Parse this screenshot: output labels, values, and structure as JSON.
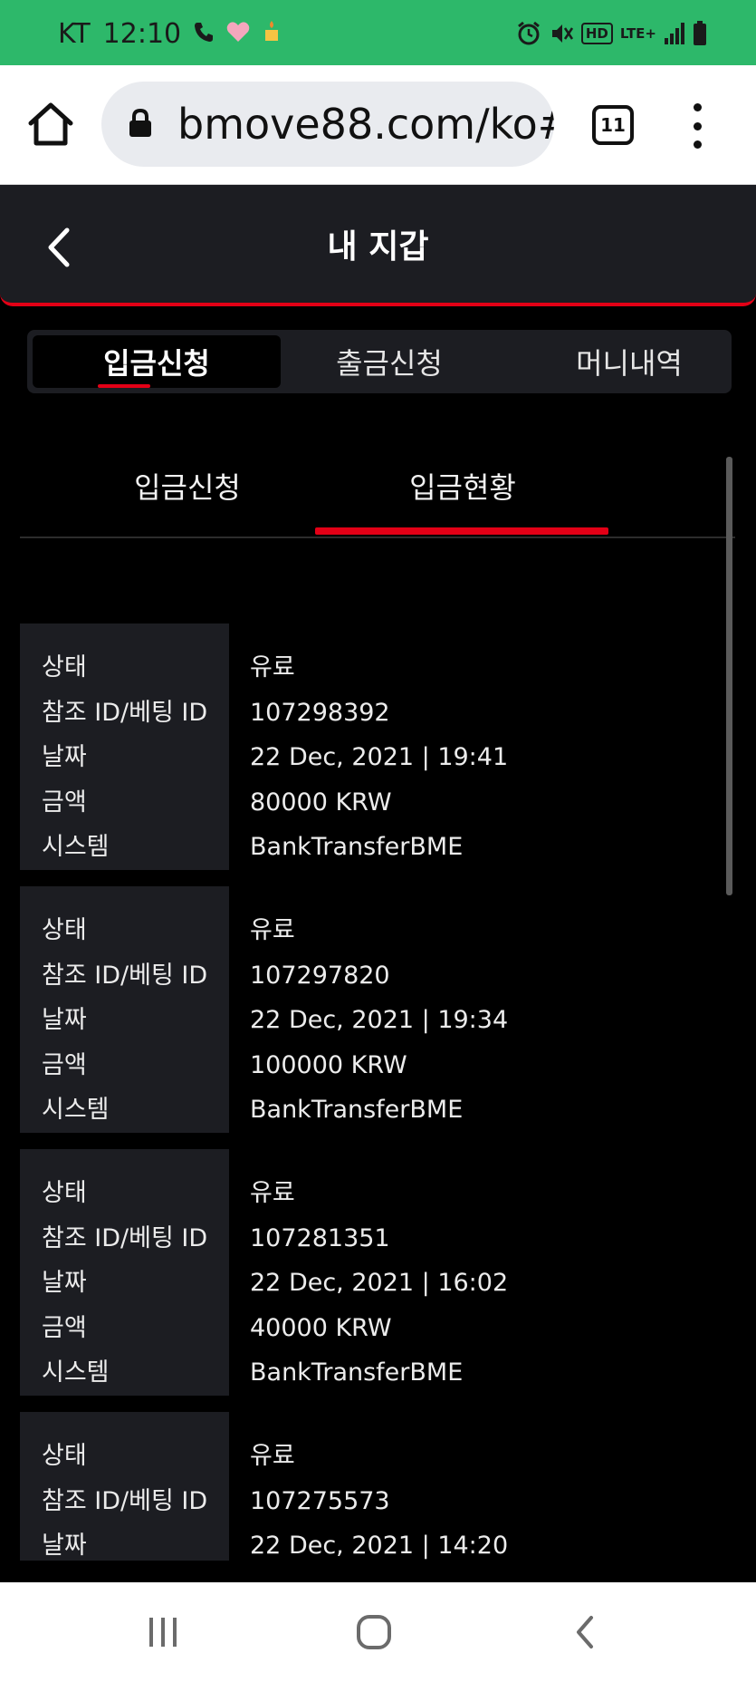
{
  "status_bar": {
    "carrier": "KT",
    "time": "12:10",
    "hd_badge": "HD",
    "network": "LTE+",
    "icons": [
      "phone-icon",
      "heart-icon",
      "notification-icon",
      "alarm-icon",
      "mute-icon",
      "hd-icon",
      "signal-icon",
      "battery-icon"
    ]
  },
  "browser": {
    "url": "bmove88.com/ko#",
    "tab_count": "11",
    "icons": [
      "home-icon",
      "lock-icon",
      "tabs-icon",
      "more-menu-icon"
    ]
  },
  "header": {
    "title": "내 지갑",
    "back_icon": "chevron-left-icon"
  },
  "main_tabs": [
    {
      "label": "입금신청",
      "active": true
    },
    {
      "label": "출금신청",
      "active": false
    },
    {
      "label": "머니내역",
      "active": false
    }
  ],
  "sub_tabs": [
    {
      "label": "입금신청",
      "active": false
    },
    {
      "label": "입금현황",
      "active": true
    }
  ],
  "field_labels": [
    "상태",
    "참조 ID/베팅 ID",
    "날짜",
    "금액",
    "시스템"
  ],
  "records": [
    {
      "status": "유료",
      "ref_id": "107298392",
      "date": "22 Dec, 2021 | 19:41",
      "amount": "80000 KRW",
      "system": "BankTransferBME"
    },
    {
      "status": "유료",
      "ref_id": "107297820",
      "date": "22 Dec, 2021 | 19:34",
      "amount": "100000 KRW",
      "system": "BankTransferBME"
    },
    {
      "status": "유료",
      "ref_id": "107281351",
      "date": "22 Dec, 2021 | 16:02",
      "amount": "40000 KRW",
      "system": "BankTransferBME"
    },
    {
      "status": "유료",
      "ref_id": "107275573",
      "date": "22 Dec, 2021 | 14:20",
      "amount": "",
      "system": ""
    }
  ],
  "nav_bar": {
    "icons": [
      "recent-apps-icon",
      "home-circle-icon",
      "back-icon"
    ]
  },
  "colors": {
    "status_bar": "#2db86a",
    "accent": "#e30016",
    "panel": "#1c1d22",
    "background": "#000000"
  }
}
